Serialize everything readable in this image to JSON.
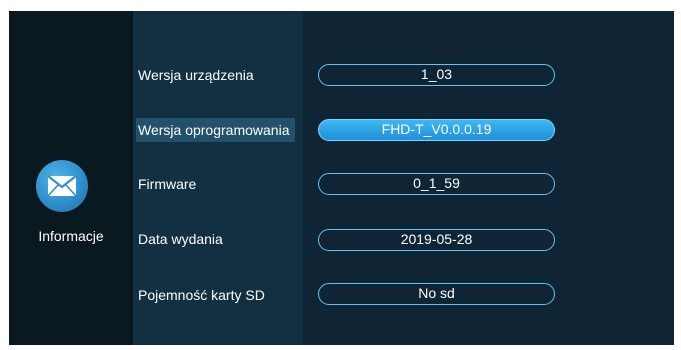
{
  "sidebar": {
    "section_label": "Informacje",
    "icon": "envelope-icon",
    "icon_color": "#2f8fcb"
  },
  "info_rows": [
    {
      "label": "Wersja urządzenia",
      "value": "1_03",
      "selected": false
    },
    {
      "label": "Wersja oprogramowania",
      "value": "FHD-T_V0.0.0.19",
      "selected": true
    },
    {
      "label": "Firmware",
      "value": "0_1_59",
      "selected": false
    },
    {
      "label": "Data wydania",
      "value": "2019-05-28",
      "selected": false
    },
    {
      "label": "Pojemność karty SD",
      "value": "No sd",
      "selected": false
    }
  ],
  "colors": {
    "accent": "#3db8f5",
    "pill_border": "#5cc7f2",
    "background": "#0c1c26"
  }
}
